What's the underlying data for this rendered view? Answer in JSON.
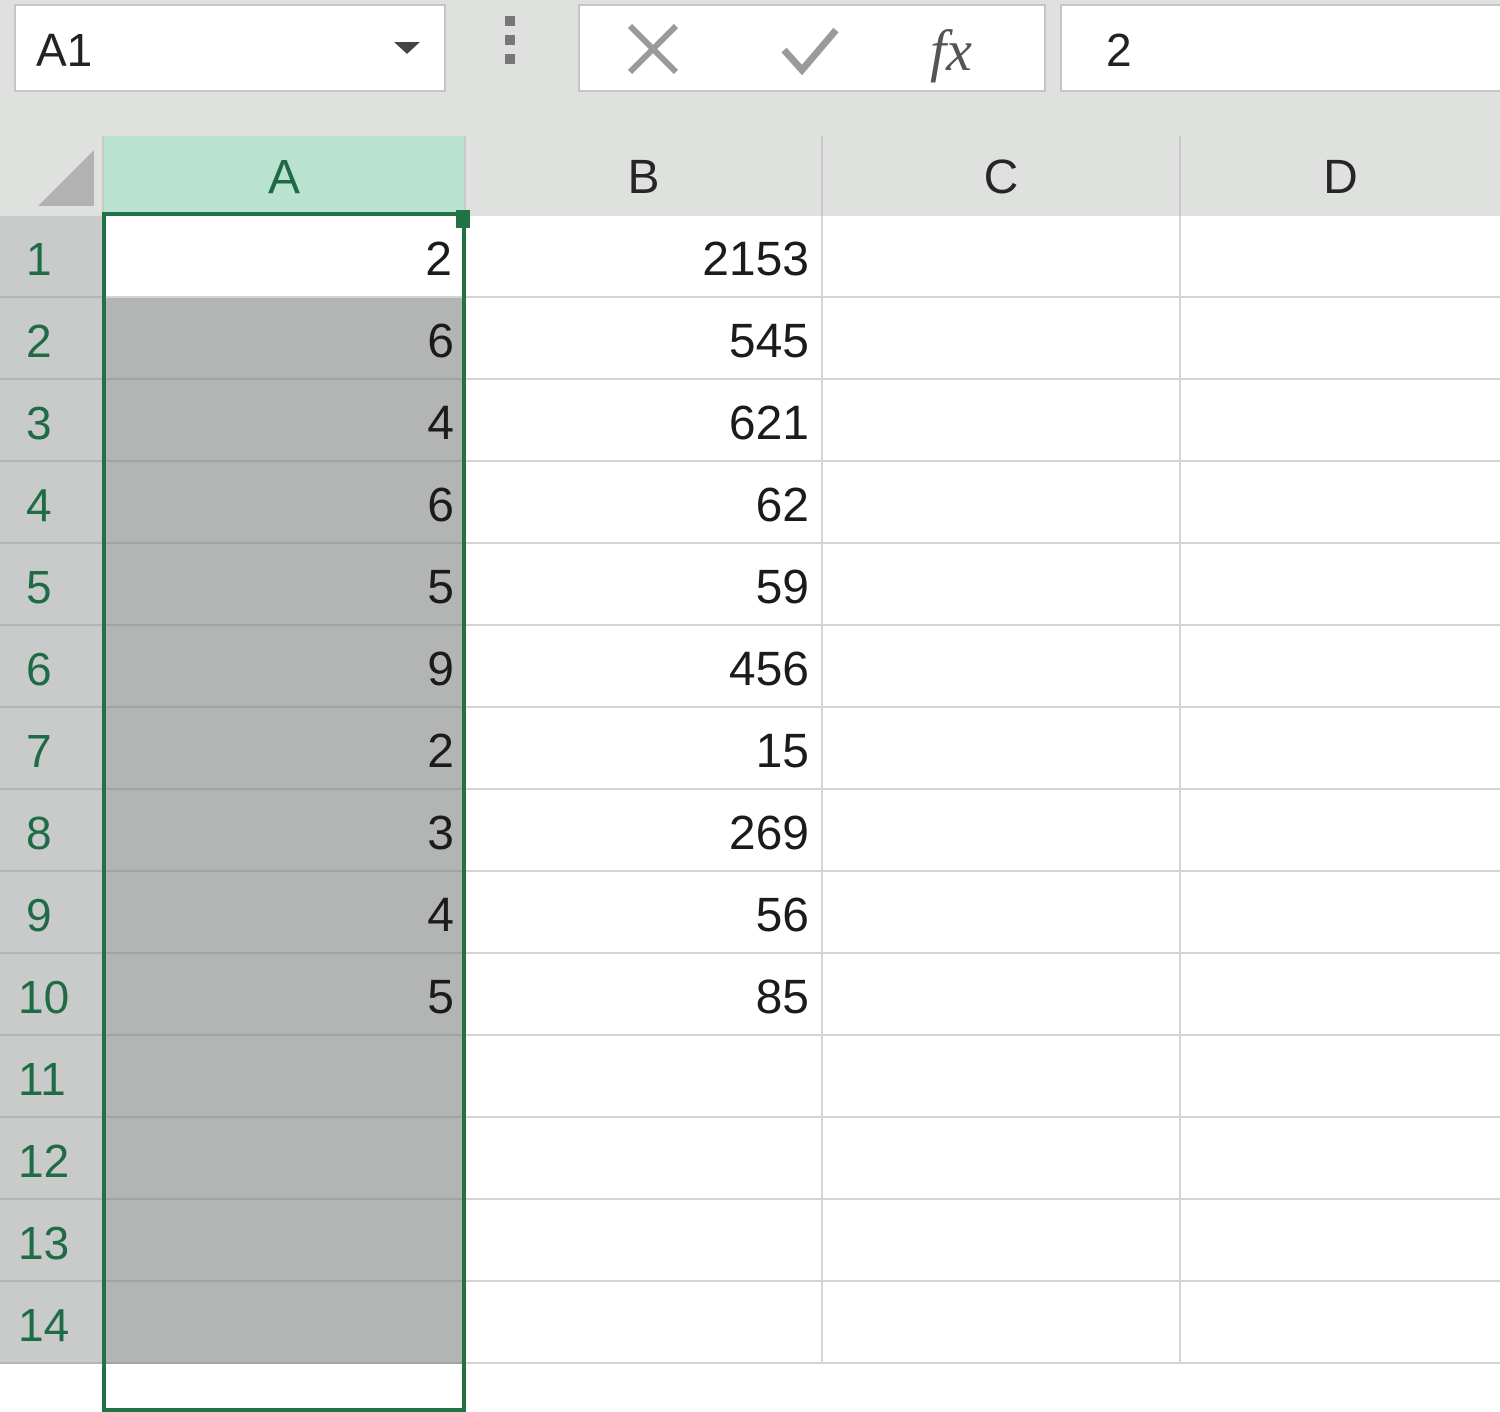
{
  "name_box": {
    "value": "A1"
  },
  "formula_bar": {
    "fx_label": "fx",
    "value": "2"
  },
  "columns": [
    "A",
    "B",
    "C",
    "D"
  ],
  "selected_column": "A",
  "active_cell": "A1",
  "rows": [
    {
      "row": "1",
      "A": "2",
      "B": "2153",
      "C": "",
      "D": ""
    },
    {
      "row": "2",
      "A": "6",
      "B": "545",
      "C": "",
      "D": ""
    },
    {
      "row": "3",
      "A": "4",
      "B": "621",
      "C": "",
      "D": ""
    },
    {
      "row": "4",
      "A": "6",
      "B": "62",
      "C": "",
      "D": ""
    },
    {
      "row": "5",
      "A": "5",
      "B": "59",
      "C": "",
      "D": ""
    },
    {
      "row": "6",
      "A": "9",
      "B": "456",
      "C": "",
      "D": ""
    },
    {
      "row": "7",
      "A": "2",
      "B": "15",
      "C": "",
      "D": ""
    },
    {
      "row": "8",
      "A": "3",
      "B": "269",
      "C": "",
      "D": ""
    },
    {
      "row": "9",
      "A": "4",
      "B": "56",
      "C": "",
      "D": ""
    },
    {
      "row": "10",
      "A": "5",
      "B": "85",
      "C": "",
      "D": ""
    },
    {
      "row": "11",
      "A": "",
      "B": "",
      "C": "",
      "D": ""
    },
    {
      "row": "12",
      "A": "",
      "B": "",
      "C": "",
      "D": ""
    },
    {
      "row": "13",
      "A": "",
      "B": "",
      "C": "",
      "D": ""
    },
    {
      "row": "14",
      "A": "",
      "B": "",
      "C": "",
      "D": ""
    }
  ],
  "colors": {
    "accent": "#217346",
    "selection_fill": "#b3b4b4",
    "header_selected": "#b9e3d0"
  }
}
